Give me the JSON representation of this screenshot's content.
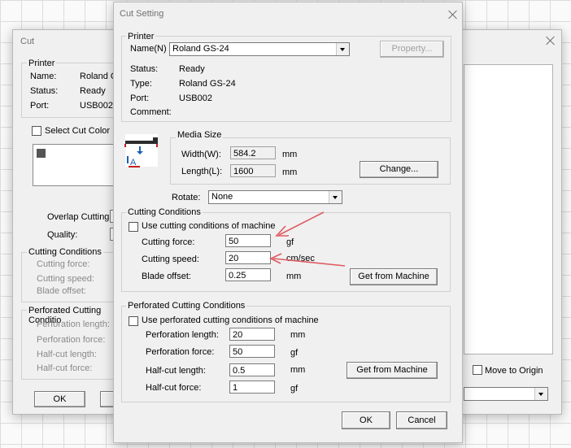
{
  "cut_window": {
    "title": "Cut",
    "printer_group": "Printer",
    "name_label": "Name:",
    "name_value": "Roland GS",
    "status_label": "Status:",
    "status_value": "Ready",
    "port_label": "Port:",
    "port_value": "USB002",
    "select_cut_color": "Select Cut Color",
    "overlap_cutting": "Overlap Cutting:",
    "quality": "Quality:",
    "cutting_conditions_group": "Cutting Conditions",
    "cutting_force": "Cutting force:",
    "cutting_speed": "Cutting speed:",
    "blade_offset": "Blade offset:",
    "perforated_group": "Perforated Cutting Conditio",
    "perforation_length": "Perforation length:",
    "perforation_force": "Perforation  force:",
    "halfcut_length": "Half-cut length:",
    "halfcut_force": "Half-cut force:",
    "ok": "OK",
    "move_to_origin": "Move to Origin"
  },
  "dialog": {
    "title": "Cut Setting",
    "printer": {
      "group_label": "Printer",
      "name_label": "Name(N)",
      "name_value": "Roland GS-24",
      "property_button": "Property...",
      "status_label": "Status:",
      "status_value": "Ready",
      "type_label": "Type:",
      "type_value": "Roland GS-24",
      "port_label": "Port:",
      "port_value": "USB002",
      "comment_label": "Comment:",
      "comment_value": ""
    },
    "media": {
      "group_label": "Media Size",
      "width_label": "Width(W):",
      "width_value": "584.2",
      "width_unit": "mm",
      "length_label": "Length(L):",
      "length_value": "1600",
      "length_unit": "mm",
      "change_button": "Change..."
    },
    "rotate": {
      "label": "Rotate:",
      "value": "None"
    },
    "cutting": {
      "group_label": "Cutting Conditions",
      "use_machine_label": "Use cutting conditions of machine",
      "use_machine_checked": false,
      "force_label": "Cutting force:",
      "force_value": "50",
      "force_unit": "gf",
      "speed_label": "Cutting speed:",
      "speed_value": "20",
      "speed_unit": "cm/sec",
      "offset_label": "Blade offset:",
      "offset_value": "0.25",
      "offset_unit": "mm",
      "get_button": "Get from Machine"
    },
    "perforated": {
      "group_label": "Perforated Cutting Conditions",
      "use_machine_label": "Use perforated cutting conditions of machine",
      "use_machine_checked": false,
      "perf_length_label": "Perforation length:",
      "perf_length_value": "20",
      "perf_length_unit": "mm",
      "perf_force_label": "Perforation  force:",
      "perf_force_value": "50",
      "perf_force_unit": "gf",
      "half_length_label": "Half-cut length:",
      "half_length_value": "0.5",
      "half_length_unit": "mm",
      "half_force_label": "Half-cut force:",
      "half_force_value": "1",
      "half_force_unit": "gf",
      "get_button": "Get from Machine"
    },
    "ok_button": "OK",
    "cancel_button": "Cancel"
  },
  "annotation_color": "#e05a62"
}
